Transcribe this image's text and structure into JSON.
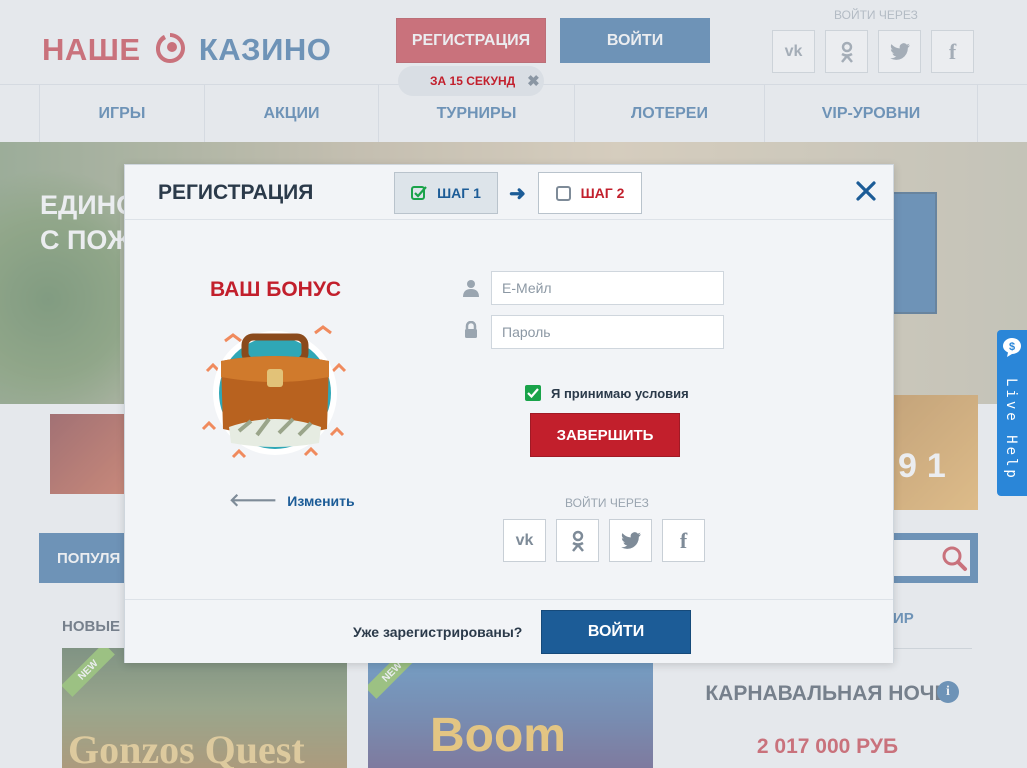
{
  "header": {
    "logo_word1": "НАШЕ",
    "logo_word2": "КАЗИНО",
    "register_label": "РЕГИСТРАЦИЯ",
    "login_label": "ВОЙТИ",
    "timer_text": "ЗА 15 СЕКУНД",
    "social_label": "ВОЙТИ ЧЕРЕЗ",
    "social": [
      "vk",
      "ok",
      "twitter",
      "facebook"
    ]
  },
  "nav": {
    "items": [
      "ИГРЫ",
      "АКЦИИ",
      "ТУРНИРЫ",
      "ЛОТЕРЕИ",
      "VIP-УРОВНИ"
    ]
  },
  "banner": {
    "line1": "ЕДИНО",
    "line2": "С ПОЖ"
  },
  "content": {
    "popular_label": "ПОПУЛЯ",
    "new_games_label": "НОВЫЕ (",
    "tournaments_label": "ИР",
    "promo_digits": "91",
    "games": [
      {
        "title": "Gonzos Quest",
        "badge": "NEW"
      },
      {
        "title": "Boom",
        "badge": "NEW"
      }
    ],
    "tournament": {
      "title": "КАРНАВАЛЬНАЯ НОЧЬ",
      "prize": "2 017 000 РУБ"
    }
  },
  "live_help": {
    "label": "Live Help"
  },
  "modal": {
    "title": "РЕГИСТРАЦИЯ",
    "steps": [
      {
        "label": "ШАГ 1",
        "checked": true
      },
      {
        "label": "ШАГ 2",
        "checked": false
      }
    ],
    "bonus_title": "ВАШ БОНУС",
    "change_label": "Изменить",
    "email_placeholder": "Е-Мейл",
    "password_placeholder": "Пароль",
    "terms_label": "Я принимаю условия",
    "terms_checked": true,
    "finish_label": "ЗАВЕРШИТЬ",
    "via_label": "ВОЙТИ ЧЕРЕЗ",
    "social": [
      "vk",
      "ok",
      "twitter",
      "facebook"
    ],
    "already_label": "Уже зарегистрированы?",
    "login_label": "ВОЙТИ"
  },
  "colors": {
    "brand_red": "#c21f2c",
    "brand_blue": "#1c5c97",
    "checkbox_green": "#1aa34a",
    "live_help_blue": "#2a86d8"
  }
}
